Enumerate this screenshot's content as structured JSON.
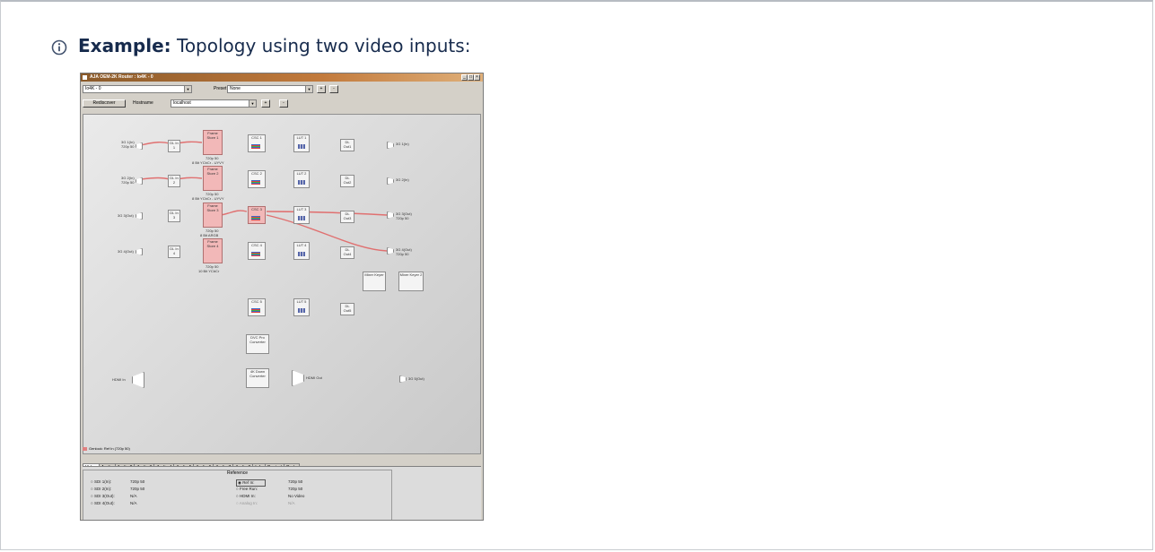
{
  "callout": {
    "label": "Example:",
    "text": "Topology using two video inputs:"
  },
  "app": {
    "title": "AJA OEM-2K Router : Io4K - 0",
    "window_buttons": [
      "_",
      "□",
      "×"
    ],
    "device_combo": "Io4K - 0",
    "preset_label": "Preset",
    "preset_value": "None",
    "rediscover_label": "Rediscover",
    "hostname_label": "Hostname",
    "hostname_value": "localhost",
    "plus": "+",
    "minus": "-"
  },
  "canvas": {
    "inputs": [
      "3G 1(In)",
      "3G 2(In)",
      "3G 3(Out)",
      "3G 4(Out)"
    ],
    "input_formats": [
      "720p 50",
      "720p 50"
    ],
    "dl_in": [
      "DL In 1",
      "DL In 2",
      "DL In 3",
      "DL In 4"
    ],
    "frame_stores": [
      {
        "label": "Frame Store 1",
        "fmt1": "720p 50",
        "fmt2": "8 Bit YCbCr - UYVY"
      },
      {
        "label": "Frame Store 2",
        "fmt1": "720p 50",
        "fmt2": "8 Bit YCbCr - UYVY"
      },
      {
        "label": "Frame Store 3",
        "fmt1": "720p 50",
        "fmt2": "8 Bit ARGB"
      },
      {
        "label": "Frame Store 4",
        "fmt1": "720p 50",
        "fmt2": "10 Bit YCbCr"
      }
    ],
    "csc": [
      "CSC 1",
      "CSC 2",
      "CSC 3",
      "CSC 4",
      "CSC 5"
    ],
    "lut": [
      "LUT 1",
      "LUT 2",
      "LUT 3",
      "LUT 4",
      "LUT 5"
    ],
    "dl_out": [
      "DL Out1",
      "DL Out2",
      "DL Out3",
      "DL Out4",
      "DL Out5"
    ],
    "outputs": [
      "3G 1(In)",
      "3G 2(In)",
      "3G 3(Out)",
      "3G 4(Out)"
    ],
    "output_formats": [
      "720p 50",
      "720p 50"
    ],
    "mixers": [
      "Mixer Keyer",
      "Mixer Keyer 2"
    ],
    "dvc_pro": "DVC Pro Converter",
    "down_conv": "4K Down Converter",
    "hdmi_in": "HDMI In",
    "hdmi_out": "HDMI Out",
    "sdi5_out": "3G 5(Out)",
    "genlock": "Genlock: Ref In (720p 50)",
    "connection_color": "#e07070"
  },
  "tabs": [
    "Video",
    "Audio",
    "Audio 2",
    "Audio 3",
    "Audio 4",
    "Audio 5",
    "Audio 6",
    "Audio 7",
    "Audio 8",
    "Info",
    "Control",
    "Code"
  ],
  "reference": {
    "title": "Reference",
    "left": [
      {
        "label": "SDI 1(In):",
        "value": "720p 50"
      },
      {
        "label": "SDI 2(In):",
        "value": "720p 50"
      },
      {
        "label": "SDI 3(Out):",
        "value": "N/A"
      },
      {
        "label": "SDI 4(Out):",
        "value": "N/A"
      }
    ],
    "right": [
      {
        "label": "Ref In:",
        "value": "720p 50"
      },
      {
        "label": "Free Run:",
        "value": "720p 50"
      },
      {
        "label": "HDMI In:",
        "value": "No Video"
      },
      {
        "label": "Analog In:",
        "value": "N/A"
      }
    ]
  }
}
